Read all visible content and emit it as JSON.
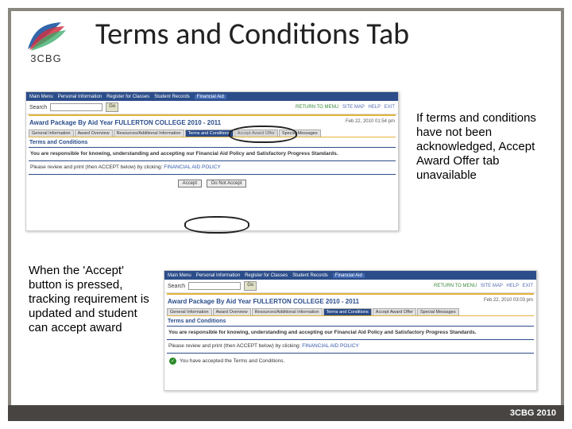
{
  "slide": {
    "title": "Terms and Conditions Tab",
    "logo_text": "3CBG",
    "footer": "3CBG 2010"
  },
  "callouts": {
    "right": "If terms and conditions have not been acknowledged, Accept Award Offer tab unavailable",
    "left": "When the 'Accept' button is pressed, tracking requirement is updated and student can accept award"
  },
  "screenshot": {
    "topnav": [
      "Main Menu",
      "Personal Information",
      "Register for Classes",
      "Student Records",
      "Financial Aid"
    ],
    "search_label": "Search",
    "go": "Go",
    "return_menu": "RETURN TO MENU",
    "links": [
      "SITE MAP",
      "HELP",
      "EXIT"
    ],
    "package_title": "Award Package By Aid Year FULLERTON COLLEGE 2010 - 2011",
    "date1": "Feb 22, 2010 01:54 pm",
    "date2": "Feb 22, 2010 03:03 pm",
    "tabs_before": [
      "General Information",
      "Award Overview",
      "Resources/Additional Information",
      "Terms and Conditions",
      "Accept Award Offer",
      "Special Messages"
    ],
    "tabs_after": [
      "General Information",
      "Award Overview",
      "Resources/Additional Information",
      "Terms and Conditions",
      "Accept Award Offer",
      "Special Messages"
    ],
    "active_tab_idx": 3,
    "disabled_tab_idx": 4,
    "section_heading": "Terms and Conditions",
    "responsible": "You are responsible for knowing, understanding and accepting our Financial Aid Policy and Satisfactory Progress Standards.",
    "review_print": "Please review and print (then ACCEPT below) by clicking:",
    "policy_link": "FINANCIAL AID POLICY",
    "accept_btn": "Accept",
    "not_accept_btn": "Do Not Accept",
    "accepted_msg": "You have accepted the Terms and Conditions."
  }
}
